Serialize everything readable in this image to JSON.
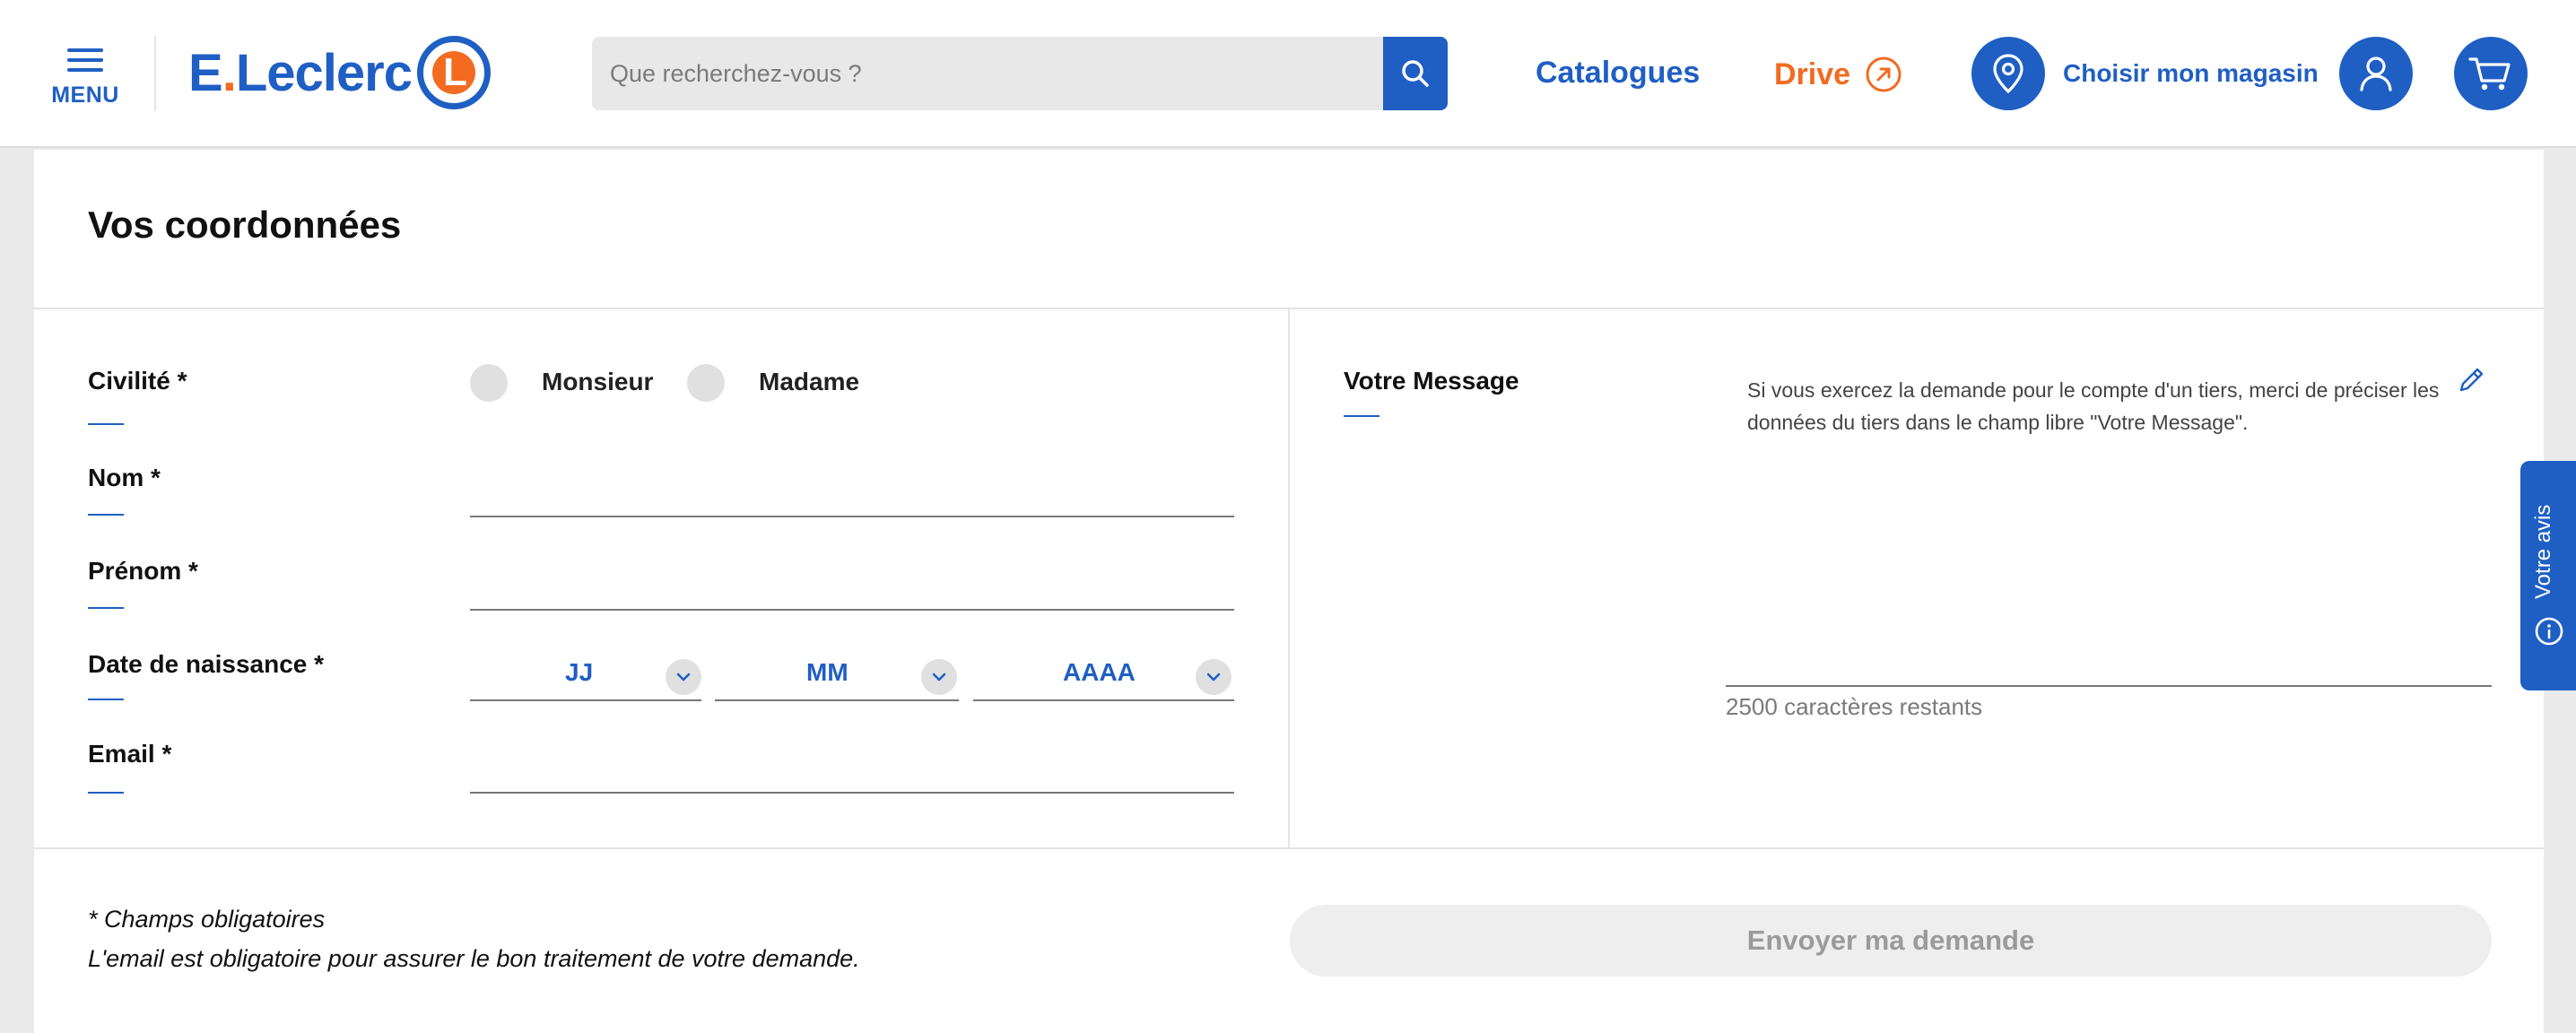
{
  "header": {
    "menu_label": "MENU",
    "logo": {
      "wordmark_prefix": "E",
      "wordmark_dot": ".",
      "wordmark_suffix": "Leclerc",
      "emblem_letter": "L"
    },
    "search_placeholder": "Que recherchez-vous ?",
    "search_icon": "search-icon",
    "nav_catalogues": "Catalogues",
    "nav_drive": "Drive",
    "drive_icon": "external-arrow-icon",
    "store_label": "Choisir mon magasin",
    "store_icon": "location-pin-icon",
    "account_icon": "user-icon",
    "cart_icon": "cart-icon"
  },
  "form": {
    "title": "Vos coordonnées",
    "civilite_label": "Civilité *",
    "civilite_options": [
      "Monsieur",
      "Madame"
    ],
    "nom_label": "Nom *",
    "nom_value": "",
    "prenom_label": "Prénom *",
    "prenom_value": "",
    "naissance_label": "Date de naissance *",
    "naissance_day": "JJ",
    "naissance_month": "MM",
    "naissance_year": "AAAA",
    "email_label": "Email *",
    "email_value": "",
    "message_label": "Votre Message",
    "message_hint": "Si vous exercez la demande pour le compte d'un tiers, merci de préciser les données du tiers dans le champ libre \"Votre Message\".",
    "message_counter": "2500 caractères restants",
    "required_note": "* Champs obligatoires",
    "email_note": "L'email est obligatoire pour assurer le bon traitement de votre demande.",
    "submit_label": "Envoyer ma demande"
  },
  "feedback": {
    "label": "Votre avis",
    "icon": "chat-bubble-icon"
  },
  "colors": {
    "brand_blue": "#1f5fc4",
    "brand_orange": "#f26b21",
    "disabled_bg": "#eeeeee",
    "disabled_text": "#9a9a9a"
  }
}
